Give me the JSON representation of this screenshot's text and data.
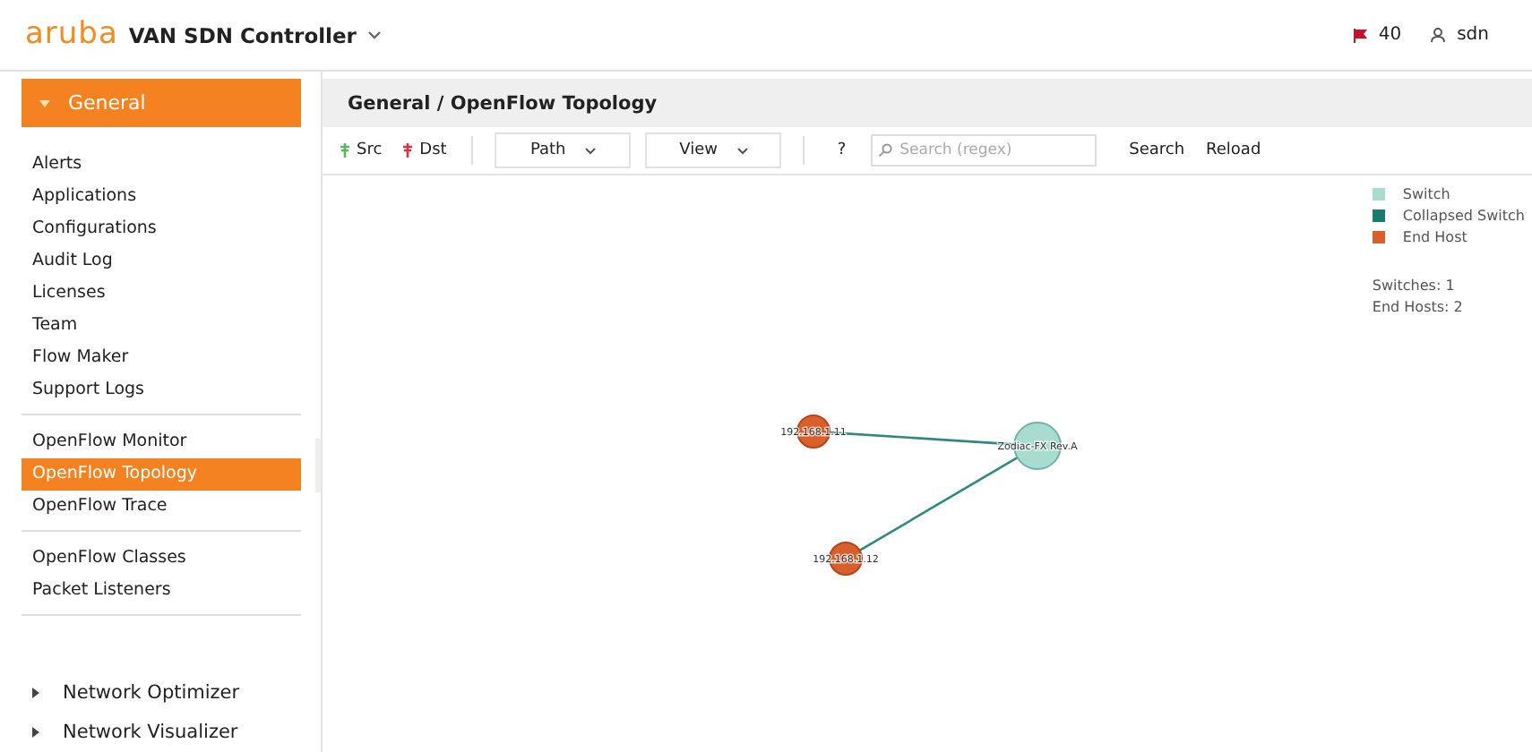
{
  "header": {
    "brand": "aruba",
    "product": "VAN SDN Controller",
    "alerts": "40",
    "user": "sdn"
  },
  "sidebar": {
    "section": {
      "label": "General",
      "expanded": true
    },
    "groups": [
      [
        {
          "label": "Alerts",
          "selected": false
        },
        {
          "label": "Applications",
          "selected": false
        },
        {
          "label": "Configurations",
          "selected": false
        },
        {
          "label": "Audit Log",
          "selected": false
        },
        {
          "label": "Licenses",
          "selected": false
        },
        {
          "label": "Team",
          "selected": false
        },
        {
          "label": "Flow Maker",
          "selected": false
        },
        {
          "label": "Support Logs",
          "selected": false
        }
      ],
      [
        {
          "label": "OpenFlow Monitor",
          "selected": false
        },
        {
          "label": "OpenFlow Topology",
          "selected": true
        },
        {
          "label": "OpenFlow Trace",
          "selected": false
        }
      ],
      [
        {
          "label": "OpenFlow Classes",
          "selected": false
        },
        {
          "label": "Packet Listeners",
          "selected": false
        }
      ]
    ],
    "collapsed_sections": [
      {
        "label": "Network Optimizer",
        "expanded": false
      },
      {
        "label": "Network Visualizer",
        "expanded": false
      }
    ]
  },
  "breadcrumb": "General / OpenFlow Topology",
  "toolbar": {
    "src": "Src",
    "dst": "Dst",
    "path": "Path",
    "view": "View",
    "help": "?",
    "search": {
      "placeholder": "Search (regex)"
    },
    "search_button": "Search",
    "reload_button": "Reload"
  },
  "legend": [
    {
      "label": "Switch",
      "color": "#a8dcd1"
    },
    {
      "label": "Collapsed Switch",
      "color": "#1f7a6e"
    },
    {
      "label": "End Host",
      "color": "#d9602b"
    }
  ],
  "stats": [
    "Switches: 1",
    "End Hosts: 2"
  ],
  "topology": {
    "nodes": [
      {
        "label": "192.168.1.11",
        "kind": "host"
      },
      {
        "label": "192.168.1.12",
        "kind": "host"
      },
      {
        "label": "Zodiac-FX Rev.A",
        "kind": "switch"
      }
    ]
  }
}
